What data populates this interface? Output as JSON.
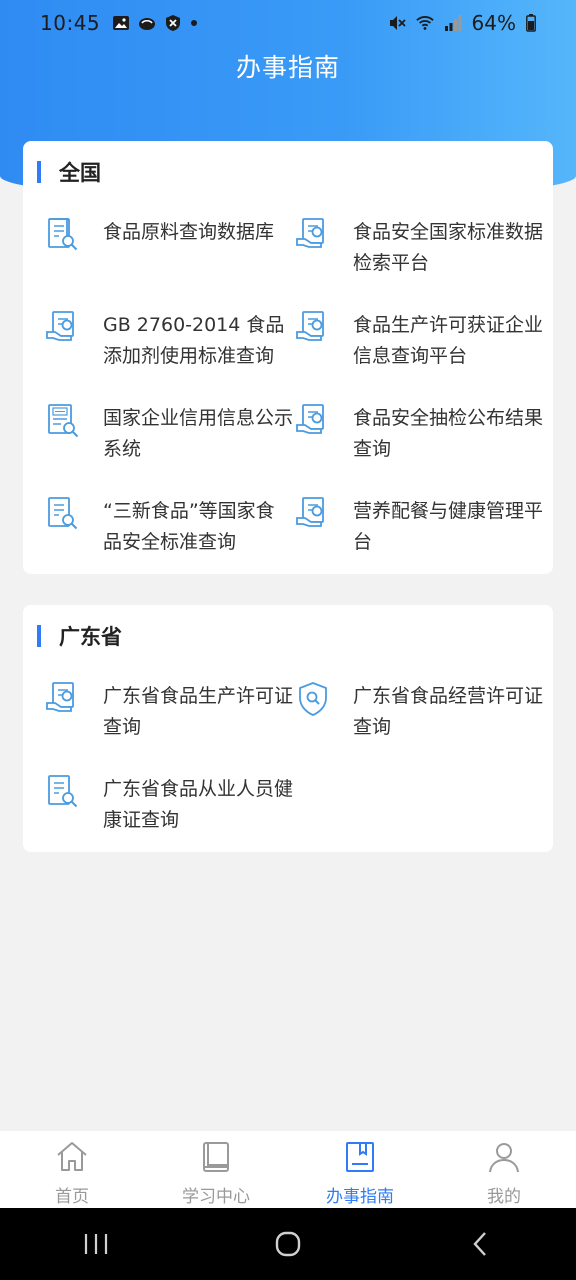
{
  "status": {
    "time": "10:45",
    "battery": "64%"
  },
  "header": {
    "title": "办事指南"
  },
  "national": {
    "title": "全国",
    "items": [
      {
        "label": "食品原料查询数据库",
        "icon": "document-search-icon"
      },
      {
        "label": "食品安全国家标准数据检索平台",
        "icon": "document-hand-icon"
      },
      {
        "label": "GB 2760-2014 食品添加剂使用标准查询",
        "icon": "document-hand-icon"
      },
      {
        "label": "食品生产许可获证企业信息查询平台",
        "icon": "document-hand-icon"
      },
      {
        "label": "国家企业信用信息公示系统",
        "icon": "credit-search-icon"
      },
      {
        "label": "食品安全抽检公布结果查询",
        "icon": "document-hand-icon"
      },
      {
        "label": "“三新食品”等国家食品安全标准查询",
        "icon": "document-search-icon"
      },
      {
        "label": "营养配餐与健康管理平台",
        "icon": "document-hand-icon"
      }
    ]
  },
  "province": {
    "title": "广东省",
    "items": [
      {
        "label": "广东省食品生产许可证查询",
        "icon": "document-hand-icon"
      },
      {
        "label": "广东省食品经营许可证查询",
        "icon": "shield-search-icon"
      },
      {
        "label": "广东省食品从业人员健康证查询",
        "icon": "document-search-icon"
      }
    ]
  },
  "tabs": [
    {
      "label": "首页",
      "icon": "home-icon"
    },
    {
      "label": "学习中心",
      "icon": "book-icon"
    },
    {
      "label": "办事指南",
      "icon": "guide-icon",
      "active": true
    },
    {
      "label": "我的",
      "icon": "user-icon"
    }
  ],
  "colors": {
    "accent": "#2f7cf6",
    "icon": "#4a9be0",
    "header_start": "#2f8bf2",
    "header_end": "#55b6fb"
  }
}
